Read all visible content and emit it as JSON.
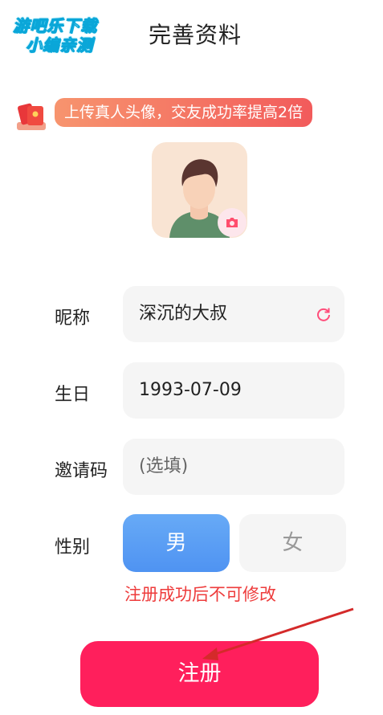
{
  "watermark": {
    "line1": "游吧乐下载",
    "line2": "小编亲测"
  },
  "header": {
    "title": "完善资料"
  },
  "tip": {
    "text": "上传真人头像，交友成功率提高2倍"
  },
  "form": {
    "nickname": {
      "label": "昵称",
      "value": "深沉的大叔"
    },
    "birthday": {
      "label": "生日",
      "value": "1993-07-09"
    },
    "invite": {
      "label": "邀请码",
      "placeholder": "(选填)"
    },
    "gender": {
      "label": "性别",
      "male": "男",
      "female": "女",
      "notice": "注册成功后不可修改"
    }
  },
  "submit": {
    "label": "注册"
  },
  "colors": {
    "accent": "#ff1f5c",
    "male_selected": "#5a9ef4",
    "notice": "#ee3b3b"
  }
}
